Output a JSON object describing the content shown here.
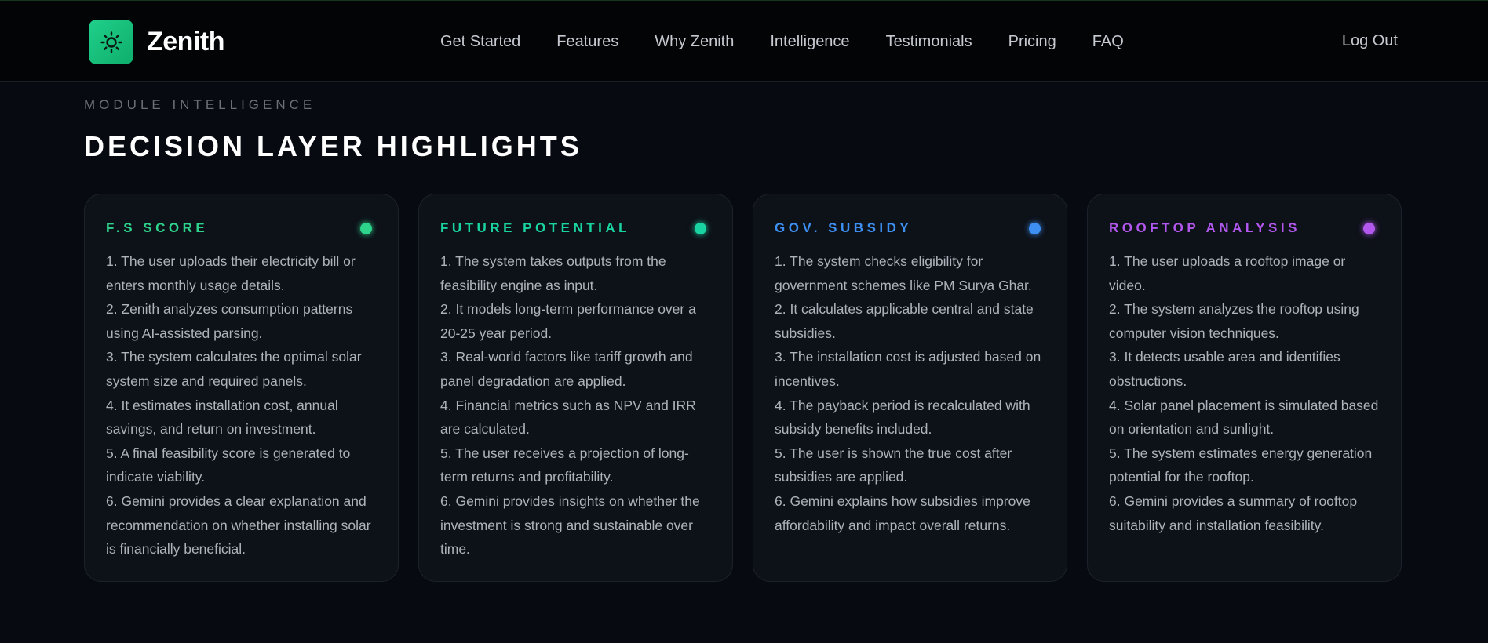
{
  "header": {
    "brand_name": "Zenith",
    "logo_icon": "sun-icon",
    "nav": [
      "Get Started",
      "Features",
      "Why Zenith",
      "Intelligence",
      "Testimonials",
      "Pricing",
      "FAQ"
    ],
    "logout_label": "Log Out"
  },
  "section": {
    "eyebrow": "MODULE INTELLIGENCE",
    "title": "DECISION LAYER HIGHLIGHTS"
  },
  "cards": [
    {
      "title": "F.S SCORE",
      "color": "#2ed38c",
      "steps": [
        "1. The user uploads their electricity bill or enters monthly usage details.",
        "2. Zenith analyzes consumption patterns using AI-assisted parsing.",
        "3. The system calculates the optimal solar system size and required panels.",
        "4. It estimates installation cost, annual savings, and return on investment.",
        "5. A final feasibility score is generated to indicate viability.",
        "6. Gemini provides a clear explanation and recommendation on whether installing solar is financially beneficial."
      ]
    },
    {
      "title": "FUTURE POTENTIAL",
      "color": "#19d4a0",
      "steps": [
        "1. The system takes outputs from the feasibility engine as input.",
        "2. It models long-term performance over a 20-25 year period.",
        "3. Real-world factors like tariff growth and panel degradation are applied.",
        "4. Financial metrics such as NPV and IRR are calculated.",
        "5. The user receives a projection of long-term returns and profitability.",
        "6. Gemini provides insights on whether the investment is strong and sustainable over time."
      ]
    },
    {
      "title": "GOV. SUBSIDY",
      "color": "#3d8ff2",
      "steps": [
        "1. The system checks eligibility for government schemes like PM Surya Ghar.",
        "2. It calculates applicable central and state subsidies.",
        "3. The installation cost is adjusted based on incentives.",
        "4. The payback period is recalculated with subsidy benefits included.",
        "5. The user is shown the true cost after subsidies are applied.",
        "6. Gemini explains how subsidies improve affordability and impact overall returns."
      ]
    },
    {
      "title": "ROOFTOP ANALYSIS",
      "color": "#b258ef",
      "steps": [
        "1. The user uploads a rooftop image or video.",
        "2. The system analyzes the rooftop using computer vision techniques.",
        "3. It detects usable area and identifies obstructions.",
        "4. Solar panel placement is simulated based on orientation and sunlight.",
        "5. The system estimates energy generation potential for the rooftop.",
        "6. Gemini provides a summary of rooftop suitability and installation feasibility."
      ]
    }
  ]
}
